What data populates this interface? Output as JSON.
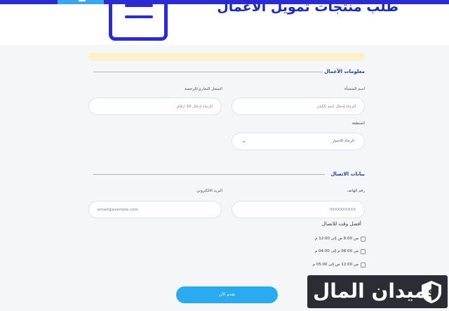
{
  "header": {
    "title": "طلب منتجات تمويل الأعمال"
  },
  "business_section": {
    "title": "معلومات الأعمال",
    "org_name_label": "اسم المنشأة",
    "org_name_placeholder": "الرجاء إدخال اسم الكيان",
    "cr_label": "السجل التجاري/الرخصة",
    "cr_placeholder": "الرجاء إدخال 10 أرقام",
    "region_label": "المنطقة",
    "region_selected": "الرجاء الاختيار"
  },
  "contact_section": {
    "title": "بيانات الاتصال",
    "phone_label": "رقم الهاتف",
    "phone_placeholder": "05XXXXXXXX",
    "email_label": "البريد الالكتروني",
    "email_placeholder": "email@example.com",
    "best_time_label": "أفضل وقت للاتصال",
    "time_options": [
      "من 8:00 ص إلى 12:00 م",
      "من 08:00 م إلى 04:00 م",
      "من 12:00 ص إلى 05:00 م"
    ]
  },
  "submit": {
    "label": "تقدم الآن"
  },
  "brand": {
    "text": "ميدان المال"
  },
  "colors": {
    "primary_blue": "#2b2bd6",
    "button_blue": "#2aaaf0",
    "notice_yellow": "#fcf0c9",
    "section_title": "#243e87"
  },
  "icons": [
    "document-icon",
    "chevron-down-icon",
    "dollar-shield-icon"
  ]
}
